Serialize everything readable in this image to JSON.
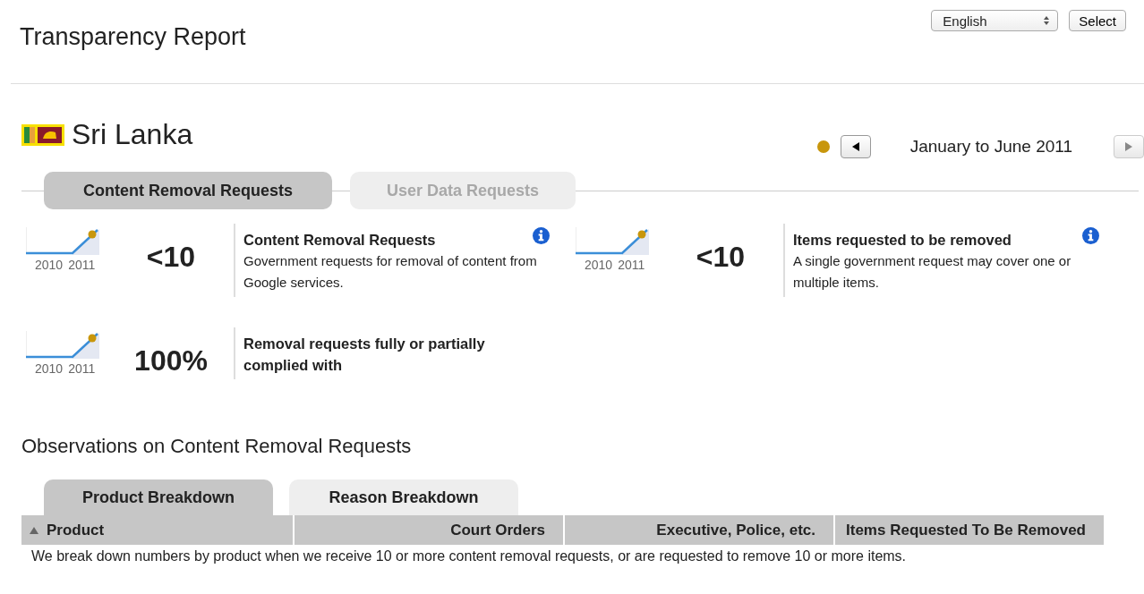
{
  "header": {
    "title": "Transparency Report",
    "language": {
      "value": "English"
    },
    "select_button": "Select"
  },
  "country": {
    "name": "Sri Lanka"
  },
  "period": {
    "label": "January to June 2011",
    "prev_disabled": false,
    "next_disabled": true
  },
  "tabs": [
    {
      "label": "Content Removal Requests",
      "selected": true,
      "disabled": false
    },
    {
      "label": "User Data Requests",
      "selected": false,
      "disabled": true
    }
  ],
  "stats": [
    {
      "sparkline_labels": [
        "2010",
        "2011"
      ],
      "value": "<10",
      "title": "Content Removal Requests",
      "description": "Government requests for removal of content from Google services.",
      "info": true
    },
    {
      "sparkline_labels": [
        "2010",
        "2011"
      ],
      "value": "<10",
      "title": "Items requested to be removed",
      "description": "A single government request may cover one or multiple items.",
      "info": true
    },
    {
      "sparkline_labels": [
        "2010",
        "2011"
      ],
      "value": "100%",
      "title": "Removal requests fully or partially complied with",
      "info": false
    }
  ],
  "observations": {
    "heading": "Observations on Content Removal Requests",
    "tabs": [
      {
        "label": "Product Breakdown",
        "selected": true
      },
      {
        "label": "Reason Breakdown",
        "selected": false
      }
    ],
    "table": {
      "columns": [
        {
          "label": "Product",
          "sorted": true
        },
        {
          "label": "Court Orders",
          "sorted": false
        },
        {
          "label": "Executive, Police, etc.",
          "sorted": false
        },
        {
          "label": "Items Requested To Be Removed",
          "sorted": false
        }
      ],
      "note": "We break down numbers by product when we receive 10 or more content removal requests, or are requested to remove 10 or more items."
    }
  }
}
